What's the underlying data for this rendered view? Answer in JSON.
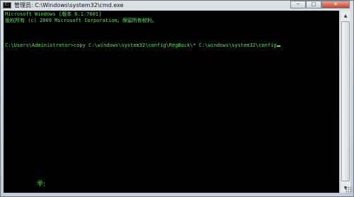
{
  "window": {
    "title": "管理员: C:\\Windows\\system32\\cmd.exe"
  },
  "controls": {
    "minimize": "─",
    "maximize": "□",
    "close": "✕"
  },
  "console": {
    "lines": [
      "Microsoft Windows [版本 6.1.7601]",
      "版权所有 (c) 2009 Microsoft Corporation。保留所有权利。",
      "",
      "C:\\Users\\Administrator>copy C:\\windows\\system32\\config\\RegBack\\* C:\\windows\\system32\\config"
    ],
    "ime_indicator": "半:"
  },
  "icons": {
    "app": "cmd-icon",
    "scroll_up": "chevron-up-icon",
    "scroll_down": "chevron-down-icon"
  },
  "colors": {
    "console_bg": "#000000",
    "console_text": "#5de25d"
  }
}
